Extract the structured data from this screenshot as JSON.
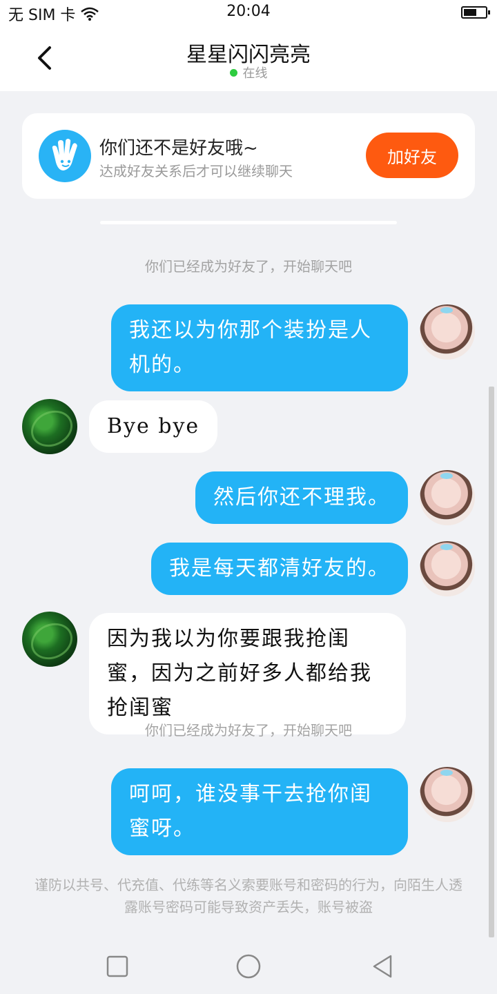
{
  "status_bar": {
    "carrier": "无 SIM 卡",
    "time": "20:04"
  },
  "header": {
    "title": "星星闪闪亮亮",
    "status": "在线"
  },
  "friend_banner": {
    "title": "你们还不是好友哦~",
    "subtitle": "达成好友关系后才可以继续聊天",
    "button_label": "加好友"
  },
  "system_notes": [
    "你们已经成为好友了，开始聊天吧",
    "你们已经成为好友了，开始聊天吧"
  ],
  "messages": [
    {
      "side": "self",
      "text": "我还以为你那个装扮是人机的。"
    },
    {
      "side": "other",
      "text": "Bye bye"
    },
    {
      "side": "self",
      "text": "然后你还不理我。"
    },
    {
      "side": "self",
      "text": "我是每天都清好友的。"
    },
    {
      "side": "other",
      "text": "因为我以为你要跟我抢闺蜜，因为之前好多人都给我抢闺蜜"
    },
    {
      "side": "self",
      "text": "呵呵，谁没事干去抢你闺蜜呀。"
    }
  ],
  "footer_warning": "谨防以共号、代充值、代练等名义索要账号和密码的行为，向陌生人透露账号密码可能导致资产丢失，账号被盗",
  "colors": {
    "self_bubble": "#23b3f6",
    "add_friend_button": "#fe5a10",
    "online_dot": "#2ecc40"
  },
  "icons": [
    "wifi-icon",
    "battery-icon",
    "back-arrow-icon",
    "hand-wave-icon",
    "recent-apps-icon",
    "home-icon",
    "back-nav-icon"
  ]
}
